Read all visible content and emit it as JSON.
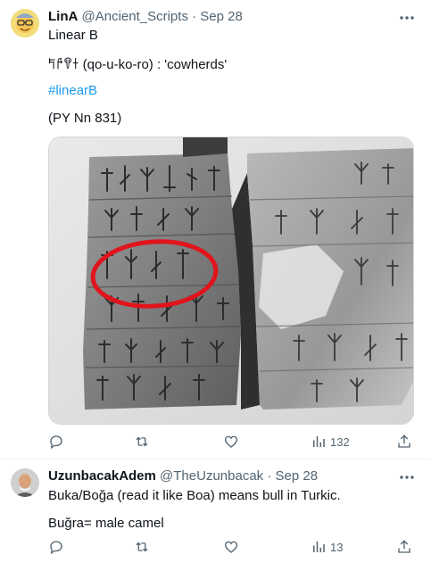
{
  "tweet1": {
    "display_name": "LinA",
    "handle": "@Ancient_Scripts",
    "separator": "·",
    "date": "Sep 28",
    "lines": [
      "Linear B",
      "𐀡𐀄𐀒𐀫 (qo-u-ko-ro) : 'cowherds'",
      "#linearB",
      "(PY Nn 831)"
    ],
    "stats": {
      "replies": "",
      "retweets": "",
      "likes": "",
      "views": "132"
    },
    "icons": {
      "more": "more-icon",
      "reply": "reply-icon",
      "retweet": "retweet-icon",
      "like": "like-icon",
      "views": "views-icon",
      "share": "share-icon"
    },
    "media_icon": "clay-tablet-photo"
  },
  "tweet2": {
    "display_name": "UzunbacakAdem",
    "handle": "@TheUzunbacak",
    "separator": "·",
    "date": "Sep 28",
    "lines": [
      "Buka/Boğa (read it like Boa) means bull in Turkic.",
      "Buğra= male camel"
    ],
    "stats": {
      "replies": "",
      "retweets": "",
      "likes": "",
      "views": "13"
    }
  },
  "colors": {
    "accent": "#1d9bf0",
    "secondary_text": "#536471",
    "highlight_circle": "#e0141c"
  }
}
